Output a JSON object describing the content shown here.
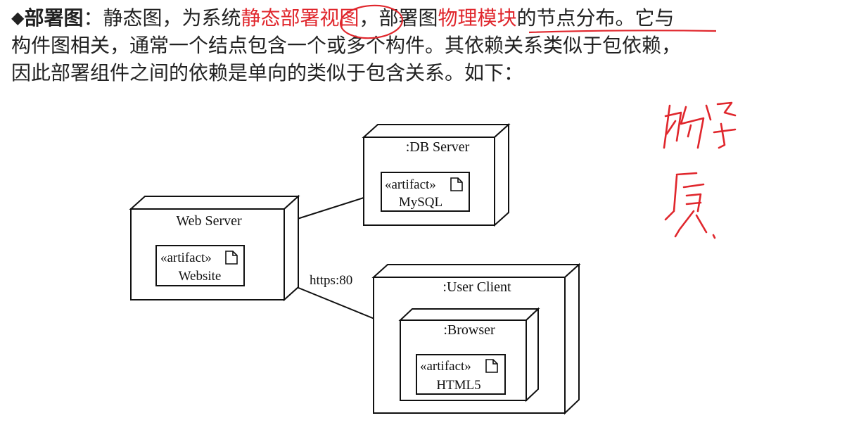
{
  "paragraph": {
    "bullet": "◆",
    "term": "部署图",
    "line1_a": "：静态图，为系统",
    "line1_b": "静态部署视图",
    "line1_c": "，部署图",
    "line1_d": "物理模块",
    "line1_e": "的节点分布。它与",
    "line2": "构件图相关，通常一个结点包含一个或多个构件。其依赖关系类似于包依赖，",
    "line3": "因此部署组件之间的依赖是单向的类似于包含关系。如下："
  },
  "diagram": {
    "nodes": {
      "web_server": {
        "name": "Web Server",
        "artifact_stereotype": "«artifact»",
        "artifact_name": "Website"
      },
      "db_server": {
        "name": ":DB Server",
        "artifact_stereotype": "«artifact»",
        "artifact_name": "MySQL"
      },
      "user_client": {
        "name": ":User Client"
      },
      "browser": {
        "name": ":Browser",
        "artifact_stereotype": "«artifact»",
        "artifact_name": "HTML5"
      }
    },
    "connection_label": "https:80"
  },
  "colors": {
    "text": "#222222",
    "highlight": "#e0262c",
    "annotation": "#e0262c",
    "diagram_line": "#111111"
  },
  "icons": {
    "artifact": "document-icon",
    "bullet": "diamond-bullet"
  }
}
